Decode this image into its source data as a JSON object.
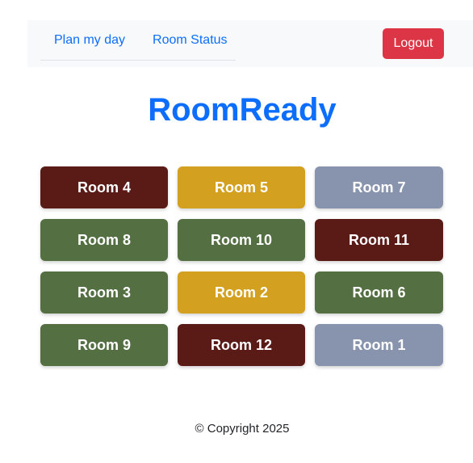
{
  "nav": {
    "links": [
      {
        "label": "Plan my day"
      },
      {
        "label": "Room Status"
      }
    ],
    "logout_label": "Logout"
  },
  "title": "RoomReady",
  "colors": {
    "occupied": "#5a1a16",
    "pending": "#d4a020",
    "vacant": "#8894ad",
    "ready": "#546f42",
    "accent": "#0d6efd",
    "logout": "#dc3545"
  },
  "rooms": [
    {
      "label": "Room 4",
      "color": "#5a1a16"
    },
    {
      "label": "Room 5",
      "color": "#d4a020"
    },
    {
      "label": "Room 7",
      "color": "#8894ad"
    },
    {
      "label": "Room 8",
      "color": "#546f42"
    },
    {
      "label": "Room 10",
      "color": "#546f42"
    },
    {
      "label": "Room 11",
      "color": "#5a1a16"
    },
    {
      "label": "Room 3",
      "color": "#546f42"
    },
    {
      "label": "Room 2",
      "color": "#d4a020"
    },
    {
      "label": "Room 6",
      "color": "#546f42"
    },
    {
      "label": "Room 9",
      "color": "#546f42"
    },
    {
      "label": "Room 12",
      "color": "#5a1a16"
    },
    {
      "label": "Room 1",
      "color": "#8894ad"
    }
  ],
  "footer": {
    "text": "© Copyright 2025"
  }
}
